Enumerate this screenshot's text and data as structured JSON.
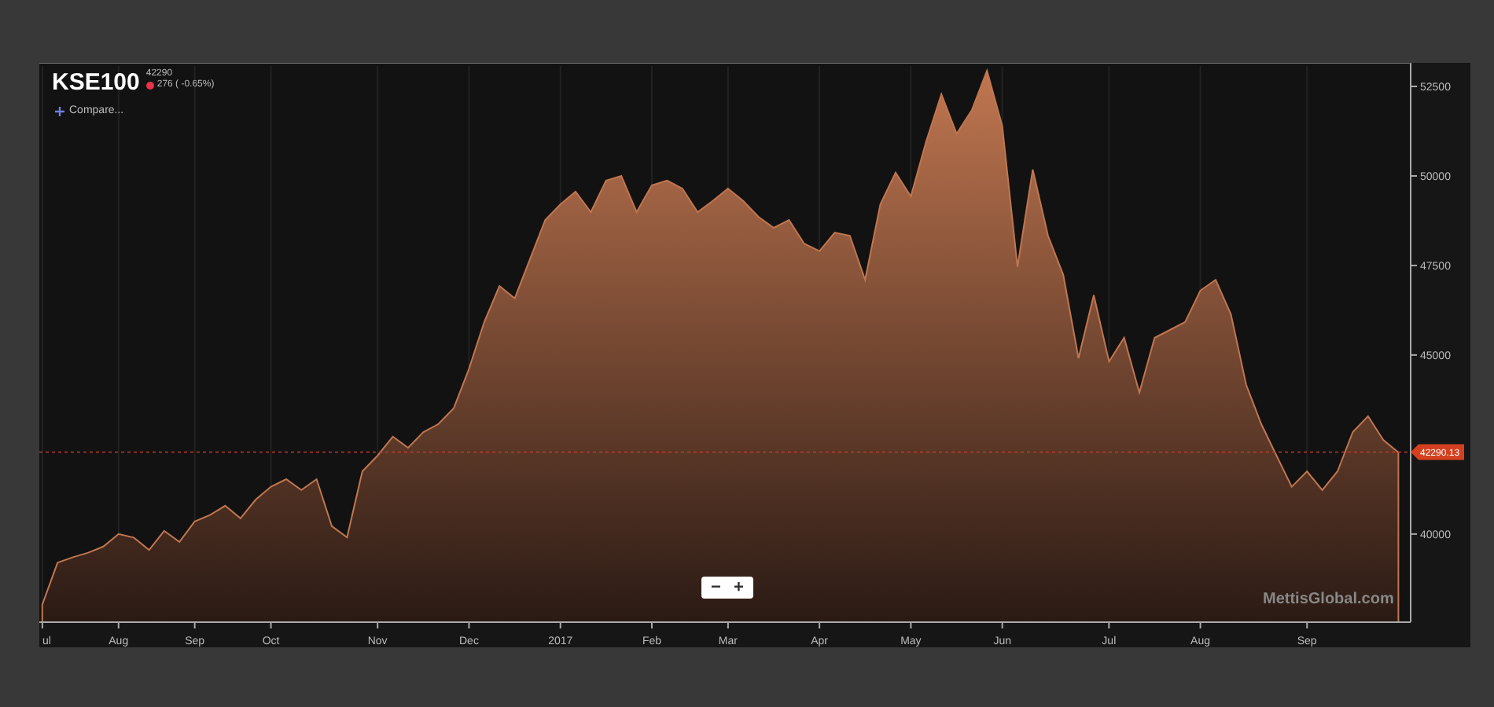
{
  "header": {
    "symbol": "KSE100",
    "last": "42290",
    "change": "276 ( -0.65%)",
    "compare": "Compare..."
  },
  "chart_data": {
    "type": "area",
    "grid": true,
    "ylim": [
      37540,
      53070
    ],
    "categories": [
      "ul",
      null,
      null,
      null,
      null,
      "Aug",
      null,
      null,
      null,
      null,
      "Sep",
      null,
      null,
      null,
      null,
      "Oct",
      null,
      null,
      null,
      null,
      null,
      null,
      "Nov",
      null,
      null,
      null,
      null,
      null,
      "Dec",
      null,
      null,
      null,
      null,
      null,
      "2017",
      null,
      null,
      null,
      null,
      null,
      "Feb",
      null,
      null,
      null,
      null,
      "Mar",
      null,
      null,
      null,
      null,
      null,
      "Apr",
      null,
      null,
      null,
      null,
      null,
      "May",
      null,
      null,
      null,
      null,
      null,
      "Jun",
      null,
      null,
      null,
      null,
      null,
      null,
      "Jul",
      null,
      null,
      null,
      null,
      null,
      "Aug",
      null,
      null,
      null,
      null,
      null,
      null,
      "Sep",
      null,
      null,
      null,
      null,
      null,
      null
    ],
    "yticks": [
      40000,
      45000,
      47500,
      50000,
      52500
    ],
    "series": [
      {
        "color": "#c07650",
        "values": [
          38030,
          39200,
          39350,
          39480,
          39650,
          40000,
          39900,
          39560,
          40090,
          39780,
          40350,
          40530,
          40790,
          40440,
          40960,
          41320,
          41530,
          41230,
          41530,
          40220,
          39910,
          41750,
          42190,
          42720,
          42410,
          42850,
          43070,
          43510,
          44610,
          45920,
          46930,
          46580,
          47680,
          48770,
          49210,
          49560,
          48990,
          49870,
          50000,
          48990,
          49740,
          49870,
          49650,
          48990,
          49300,
          49650,
          49300,
          48860,
          48550,
          48770,
          48110,
          47900,
          48420,
          48330,
          47100,
          49210,
          50090,
          49430,
          50960,
          52280,
          51180,
          51840,
          52940,
          51400,
          47460,
          50180,
          48330,
          47240,
          44910,
          46670,
          44820,
          45480,
          43950,
          45480,
          45700,
          45920,
          46800,
          47100,
          46140,
          44170,
          43070,
          42190,
          41320,
          41750,
          41230,
          41750,
          42850,
          43290,
          42630,
          42280
        ]
      }
    ],
    "ref_lines": [
      {
        "axis": "y",
        "value": 42290.13,
        "label": "42290.13"
      }
    ]
  },
  "zoom_buttons": [
    "−",
    "+"
  ],
  "credit": "MettisGlobal.com"
}
